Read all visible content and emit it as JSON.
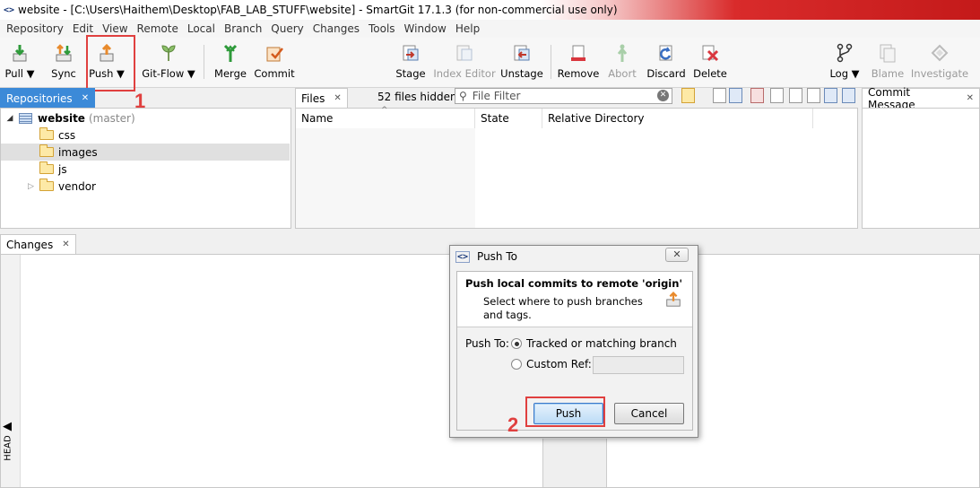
{
  "window": {
    "app_icon": "<>",
    "title": "website - [C:\\Users\\Haithem\\Desktop\\FAB_LAB_STUFF\\website] - SmartGit 17.1.3 (for non-commercial use only)"
  },
  "menu": [
    "Repository",
    "Edit",
    "View",
    "Remote",
    "Local",
    "Branch",
    "Query",
    "Changes",
    "Tools",
    "Window",
    "Help"
  ],
  "toolbar": {
    "pull": "Pull ▼",
    "sync": "Sync",
    "push": "Push ▼",
    "gitflow": "Git-Flow ▼",
    "merge": "Merge",
    "commit": "Commit",
    "stage": "Stage",
    "index_editor": "Index Editor",
    "unstage": "Unstage",
    "remove": "Remove",
    "abort": "Abort",
    "discard": "Discard",
    "delete": "Delete",
    "log": "Log ▼",
    "blame": "Blame",
    "investigate": "Investigate"
  },
  "annotations": {
    "one": "1",
    "two": "2"
  },
  "repositories": {
    "tab": "Repositories",
    "repo_name": "website",
    "repo_branch": "(master)",
    "folders": [
      "css",
      "images",
      "js",
      "vendor"
    ]
  },
  "files": {
    "tab": "Files",
    "hidden": "52 files hidden",
    "filter_placeholder": "File Filter",
    "columns": [
      "Name",
      "State",
      "Relative Directory"
    ]
  },
  "commit_message": {
    "tab": "Commit Message"
  },
  "changes": {
    "tab": "Changes",
    "head_label": "HEAD"
  },
  "dialog": {
    "title": "Push To",
    "heading": "Push local commits to remote 'origin'",
    "description": "Select where to push branches and tags.",
    "push_to_label": "Push To:",
    "option_tracked": "Tracked or matching branch",
    "option_custom": "Custom Ref:",
    "push_button": "Push",
    "cancel_button": "Cancel"
  },
  "colors": {
    "accent": "#3c8ad8",
    "annotation": "#e0403f"
  }
}
